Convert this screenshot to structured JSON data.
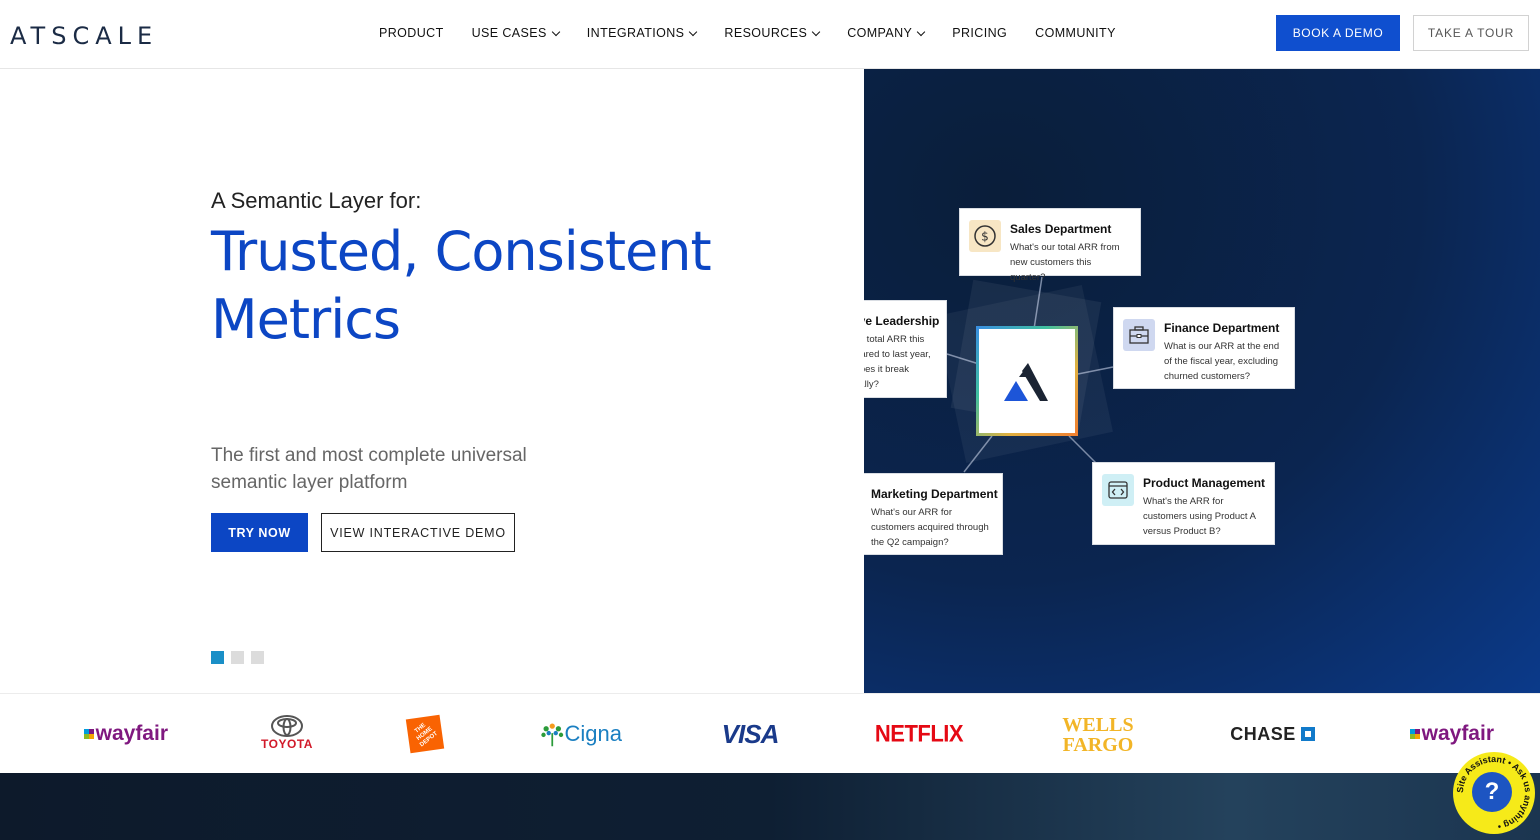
{
  "header": {
    "logo_text": "ATSCALE",
    "nav": [
      {
        "label": "PRODUCT",
        "dropdown": false
      },
      {
        "label": "USE CASES",
        "dropdown": true
      },
      {
        "label": "INTEGRATIONS",
        "dropdown": true
      },
      {
        "label": "RESOURCES",
        "dropdown": true
      },
      {
        "label": "COMPANY",
        "dropdown": true
      },
      {
        "label": "PRICING",
        "dropdown": false
      },
      {
        "label": "COMMUNITY",
        "dropdown": false
      }
    ],
    "book_demo_label": "BOOK A DEMO",
    "take_tour_label": "TAKE A TOUR"
  },
  "hero": {
    "pre_title": "A Semantic Layer for:",
    "title": "Trusted, Consistent Metrics",
    "subtitle": "The first and most complete universal semantic layer platform",
    "try_now_label": "TRY NOW",
    "view_demo_label": "VIEW INTERACTIVE DEMO",
    "slides_total": 3,
    "slide_active": 1
  },
  "diagram": {
    "cards": [
      {
        "title": "Sales Department",
        "text": "What's our total ARR from new customers this quarter?",
        "icon": "dollar-icon"
      },
      {
        "title": "Executive Leadership",
        "text": "What is our total ARR this year compared to last year, and how does it break down globally?",
        "icon": "handshake-icon"
      },
      {
        "title": "Finance Department",
        "text": "What is our ARR at the end of the fiscal year, excluding churned customers?",
        "icon": "briefcase-icon"
      },
      {
        "title": "Marketing Department",
        "text": "What's our ARR for customers acquired through the Q2 campaign?",
        "icon": "target-icon"
      },
      {
        "title": "Product Management",
        "text": "What's the ARR for customers using Product A versus Product B?",
        "icon": "code-window-icon"
      }
    ]
  },
  "logos": {
    "wayfair": "wayfair",
    "toyota": "TOYOTA",
    "homedepot": "THE HOME DEPOT",
    "cigna": "Cigna",
    "visa": "VISA",
    "netflix": "NETFLIX",
    "wells_line1": "WELLS",
    "wells_line2": "FARGO",
    "chase": "CHASE",
    "wayfair2": "wayfair"
  },
  "assistant": {
    "label": "Site Assistant • Ask us anything •",
    "symbol": "?"
  },
  "colors": {
    "brand_blue": "#0c46c4",
    "button_blue": "#0f4fcf",
    "assistant_yellow": "#f6ea19"
  }
}
